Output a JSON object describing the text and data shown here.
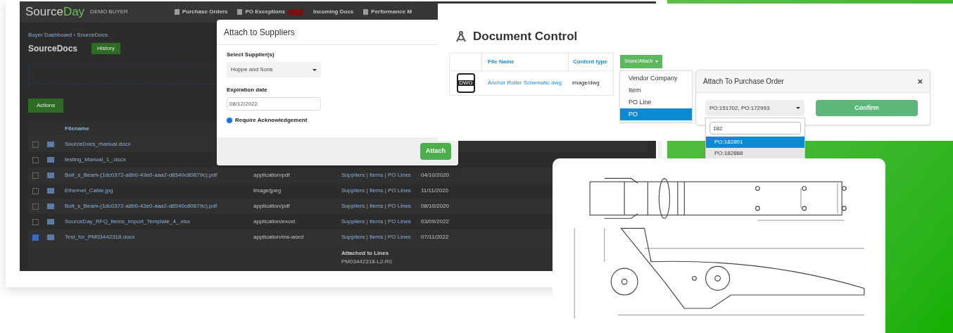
{
  "app_window": {
    "logo": {
      "part_a": "Source",
      "part_b": "Day"
    },
    "badge": "DEMO BUYER",
    "nav": [
      {
        "label": "Purchase Orders",
        "kind": "plain"
      },
      {
        "label": "PO Exceptions",
        "kind": "count"
      },
      {
        "label": "Incoming Docs",
        "kind": "none"
      },
      {
        "label": "Performance M",
        "kind": "plain"
      }
    ],
    "breadcrumb": "Buyer Dashboard › SourceDocs",
    "page_title": "SourceDocs",
    "history_button": "History",
    "actions_button": "Actions",
    "table": {
      "columns": [
        "Filename"
      ],
      "rows": [
        {
          "filename": "SourceDocs_manual.docx",
          "content_type": "",
          "links": "",
          "date": "",
          "checked": false
        },
        {
          "filename": "testing_Manual_1_.docx",
          "content_type": "",
          "links": "",
          "date": "",
          "checked": false
        },
        {
          "filename": "Bolt_s_Beam-(1dc0372-a8b0-43e0-aaa2-d8540c80879c).pdf",
          "content_type": "application/pdf",
          "links": "Suppliers | Items | PO Lines",
          "date": "04/10/2020",
          "checked": false
        },
        {
          "filename": "Ethernet_Cable.jpg",
          "content_type": "image/jpeg",
          "links": "Suppliers | Items | PO Lines",
          "date": "11/11/2020",
          "checked": false
        },
        {
          "filename": "Bolt_s_Beam-(1dc0372-a8b0-43e0-aaa2-d8540c80879c).pdf",
          "content_type": "application/pdf",
          "links": "Suppliers | Items | PO Lines",
          "date": "08/10/2020",
          "checked": false
        },
        {
          "filename": "SourceDay_RFQ_Items_Import_Template_4_.xlsx",
          "content_type": "application/excel",
          "links": "Suppliers | Items | PO Lines",
          "date": "03/09/2022",
          "checked": false
        },
        {
          "filename": "Test_for_PM03442318.docx",
          "content_type": "application/ms-word",
          "links": "Suppliers | Items | PO Lines",
          "date": "07/11/2022",
          "checked": true
        }
      ]
    },
    "attached_note": {
      "label": "Attached to Lines",
      "value": "PM03442318-L2-R0"
    }
  },
  "attach_dialog": {
    "title": "Attach to Suppliers",
    "supplier_label": "Select Supplier(s)",
    "supplier_value": "Hoppe and Sons",
    "expiration_label": "Expiration date",
    "expiration_value": "08/12/2022",
    "require_ack": {
      "label": "Require Acknowledgement",
      "checked": true
    },
    "attach_button": "Attach"
  },
  "document_control": {
    "title": "Document Control",
    "columns": [
      "File Name",
      "Content type"
    ],
    "rows": [
      {
        "icon_label": "DWG",
        "file_name": "Anchor Roller Schematic.dwg",
        "content_type": "image/dwg"
      }
    ],
    "share_button": "Share/Attach",
    "menu": [
      {
        "label": "Vendor Company",
        "selected": false
      },
      {
        "label": "Item",
        "selected": false
      },
      {
        "label": "PO Line",
        "selected": false
      },
      {
        "label": "PO",
        "selected": true
      }
    ],
    "po_dialog": {
      "title": "Attach To Purchase Order",
      "close": "×",
      "select_value": "PO:151702, PO:172993",
      "confirm_button": "Confirm",
      "search_value": "182",
      "options": [
        {
          "label": "PO:182801",
          "selected": true
        },
        {
          "label": "PO:182888",
          "selected": false
        }
      ]
    }
  }
}
